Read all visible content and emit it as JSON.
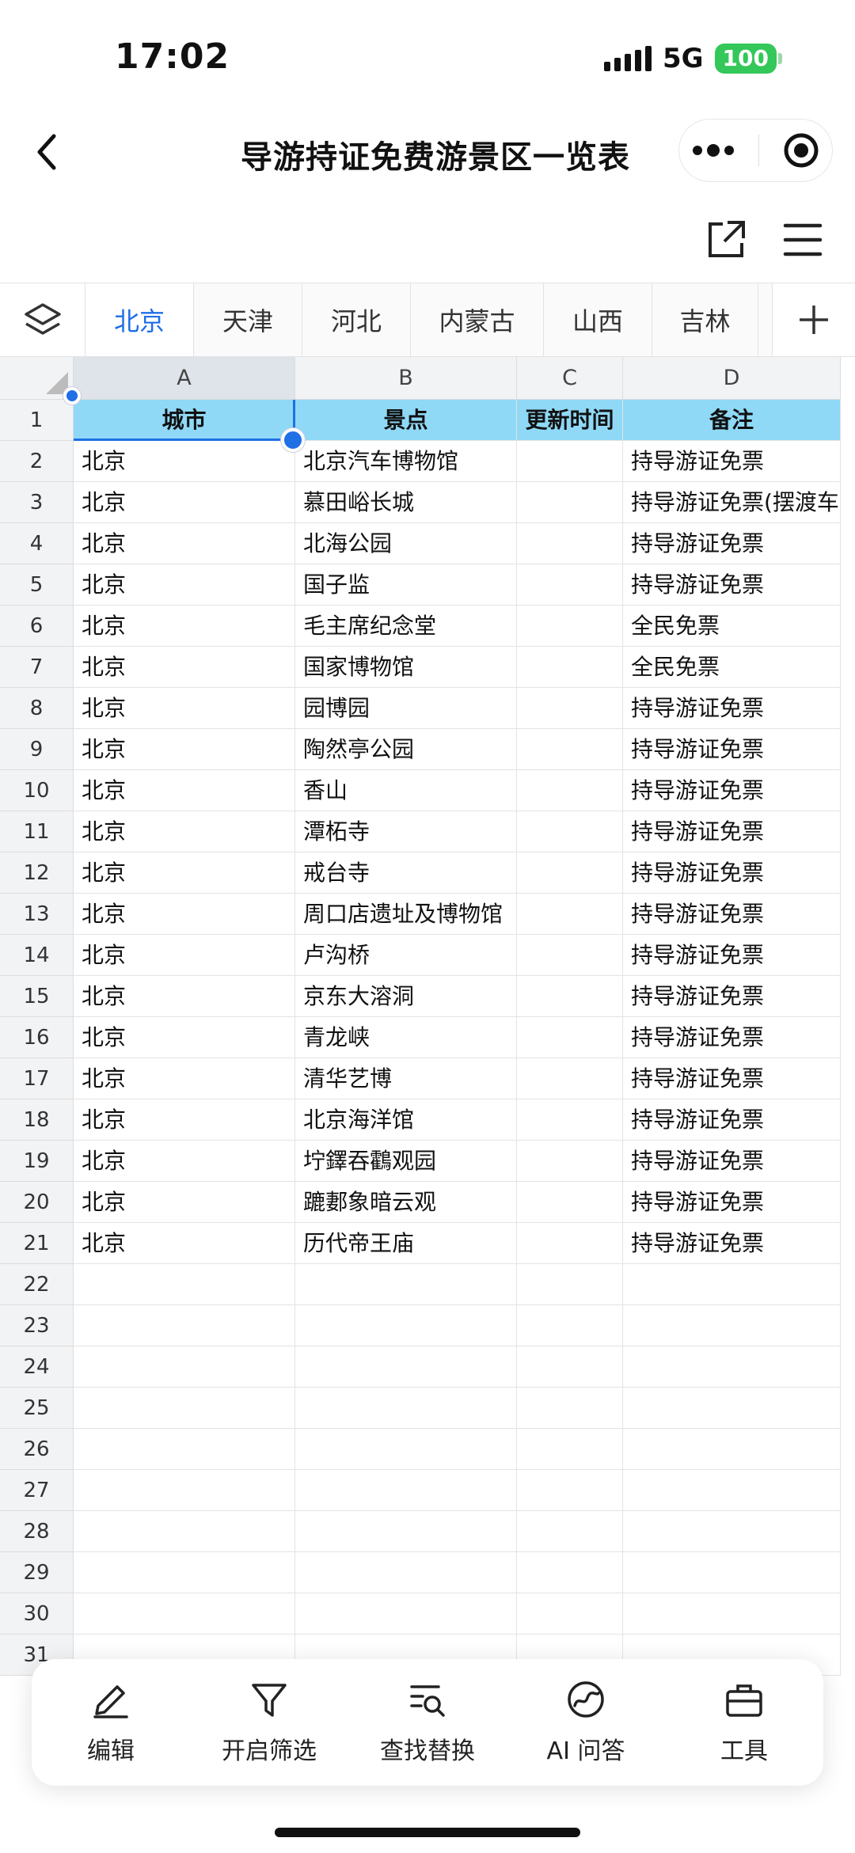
{
  "status_bar": {
    "time": "17:02",
    "network": "5G",
    "battery": "100"
  },
  "header": {
    "title": "导游持证免费游景区一览表"
  },
  "tabs": [
    "北京",
    "天津",
    "河北",
    "内蒙古",
    "山西",
    "吉林"
  ],
  "active_tab": "北京",
  "columns": [
    "A",
    "B",
    "C",
    "D"
  ],
  "header_row": {
    "row_num": "1",
    "cells": [
      "城市",
      "景点",
      "更新时间",
      "备注"
    ]
  },
  "rows": [
    {
      "n": "2",
      "city": "北京",
      "spot": "北京汽车博物馆",
      "time": "",
      "note": "持导游证免票"
    },
    {
      "n": "3",
      "city": "北京",
      "spot": "慕田峪长城",
      "time": "",
      "note": "持导游证免票(摆渡车"
    },
    {
      "n": "4",
      "city": "北京",
      "spot": "北海公园",
      "time": "",
      "note": "持导游证免票"
    },
    {
      "n": "5",
      "city": "北京",
      "spot": "国子监",
      "time": "",
      "note": "持导游证免票"
    },
    {
      "n": "6",
      "city": "北京",
      "spot": "毛主席纪念堂",
      "time": "",
      "note": "全民免票"
    },
    {
      "n": "7",
      "city": "北京",
      "spot": "国家博物馆",
      "time": "",
      "note": "全民免票"
    },
    {
      "n": "8",
      "city": "北京",
      "spot": "园博园",
      "time": "",
      "note": "持导游证免票"
    },
    {
      "n": "9",
      "city": "北京",
      "spot": "陶然亭公园",
      "time": "",
      "note": "持导游证免票"
    },
    {
      "n": "10",
      "city": "北京",
      "spot": "香山",
      "time": "",
      "note": "持导游证免票"
    },
    {
      "n": "11",
      "city": "北京",
      "spot": "潭柘寺",
      "time": "",
      "note": "持导游证免票"
    },
    {
      "n": "12",
      "city": "北京",
      "spot": "戒台寺",
      "time": "",
      "note": "持导游证免票"
    },
    {
      "n": "13",
      "city": "北京",
      "spot": "周口店遗址及博物馆",
      "time": "",
      "note": "持导游证免票"
    },
    {
      "n": "14",
      "city": "北京",
      "spot": "卢沟桥",
      "time": "",
      "note": "持导游证免票"
    },
    {
      "n": "15",
      "city": "北京",
      "spot": "京东大溶洞",
      "time": "",
      "note": "持导游证免票"
    },
    {
      "n": "16",
      "city": "北京",
      "spot": "青龙峡",
      "time": "",
      "note": "持导游证免票"
    },
    {
      "n": "17",
      "city": "北京",
      "spot": "清华艺博",
      "time": "",
      "note": "持导游证免票"
    },
    {
      "n": "18",
      "city": "北京",
      "spot": "北京海洋馆",
      "time": "",
      "note": "持导游证免票"
    },
    {
      "n": "19",
      "city": "北京",
      "spot": "坾鐸吞鸖观园",
      "time": "",
      "note": "持导游证免票"
    },
    {
      "n": "20",
      "city": "北京",
      "spot": "蹗郪象暗云观",
      "time": "",
      "note": "持导游证免票"
    },
    {
      "n": "21",
      "city": "北京",
      "spot": "历代帝王庙",
      "time": "",
      "note": "持导游证免票"
    },
    {
      "n": "22",
      "city": "",
      "spot": "",
      "time": "",
      "note": ""
    },
    {
      "n": "23",
      "city": "",
      "spot": "",
      "time": "",
      "note": ""
    },
    {
      "n": "24",
      "city": "",
      "spot": "",
      "time": "",
      "note": ""
    },
    {
      "n": "25",
      "city": "",
      "spot": "",
      "time": "",
      "note": ""
    },
    {
      "n": "26",
      "city": "",
      "spot": "",
      "time": "",
      "note": ""
    },
    {
      "n": "27",
      "city": "",
      "spot": "",
      "time": "",
      "note": ""
    },
    {
      "n": "28",
      "city": "",
      "spot": "",
      "time": "",
      "note": ""
    },
    {
      "n": "29",
      "city": "",
      "spot": "",
      "time": "",
      "note": ""
    },
    {
      "n": "30",
      "city": "",
      "spot": "",
      "time": "",
      "note": ""
    },
    {
      "n": "31",
      "city": "",
      "spot": "",
      "time": "",
      "note": ""
    }
  ],
  "bottom_bar": {
    "edit": "编辑",
    "filter": "开启筛选",
    "find_replace": "查找替换",
    "ai_qa": "AI 问答",
    "tools": "工具"
  },
  "colors": {
    "accent": "#1f6fe5",
    "header_fill": "#8fd9f7",
    "battery": "#34c759"
  }
}
